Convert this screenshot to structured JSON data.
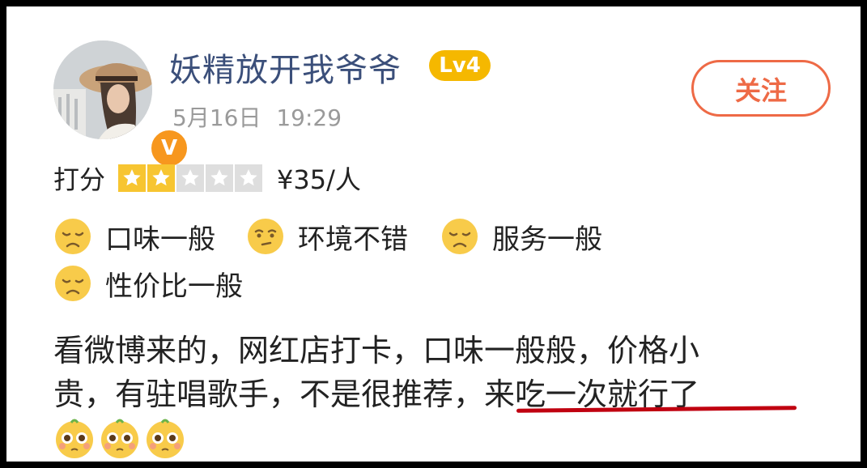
{
  "user": {
    "name": "妖精放开我爷爷",
    "level": "Lv4",
    "verified_badge": "V",
    "post_time": "5月16日  19:29"
  },
  "follow_button": {
    "label": "关注"
  },
  "rating": {
    "label": "打分",
    "stars_filled": 2,
    "stars_total": 5,
    "price": "¥35/人"
  },
  "tags": [
    {
      "icon": "sad-face-icon",
      "label": "口味一般"
    },
    {
      "icon": "neutral-face-icon",
      "label": "环境不错"
    },
    {
      "icon": "sad-face-icon",
      "label": "服务一般"
    },
    {
      "icon": "sad-face-icon",
      "label": "性价比一般"
    }
  ],
  "review": {
    "line1": "看微博来的，网红店打卡，口味一般般，价格小",
    "line2_part1": "贵，有驻唱歌手，不是很推荐",
    "line2_part2": "，来吃一次就行了"
  },
  "trailing_emojis": [
    "pleading-face-icon",
    "pleading-face-icon",
    "pleading-face-icon"
  ],
  "colors": {
    "username": "#3b4f7a",
    "level_badge": "#f5b800",
    "follow_accent": "#ee6a46",
    "star_filled": "#f7c531",
    "underline": "#c00010"
  }
}
